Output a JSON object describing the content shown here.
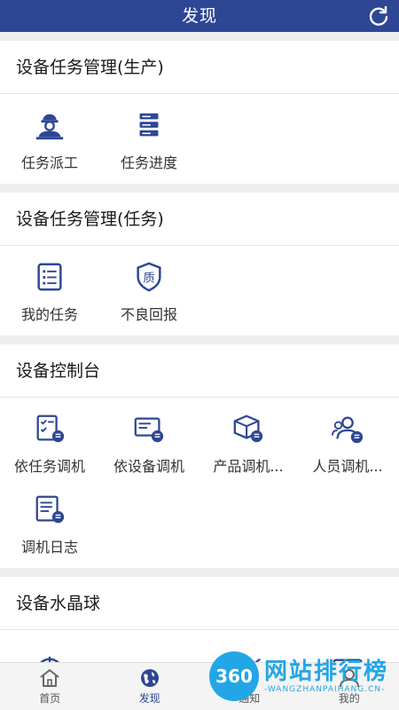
{
  "header": {
    "title": "发现",
    "refresh_icon": "refresh-icon"
  },
  "colors": {
    "primary": "#2e4795",
    "background": "#eeeeee",
    "watermark": "#23a6e6"
  },
  "sections": [
    {
      "title": "设备任务管理(生产)",
      "items": [
        {
          "label": "任务派工",
          "icon": "worker-icon"
        },
        {
          "label": "任务进度",
          "icon": "stack-icon"
        }
      ]
    },
    {
      "title": "设备任务管理(任务)",
      "items": [
        {
          "label": "我的任务",
          "icon": "list-icon"
        },
        {
          "label": "不良回报",
          "icon": "shield-quality-icon",
          "glyph": "质"
        }
      ]
    },
    {
      "title": "设备控制台",
      "items": [
        {
          "label": "依任务调机",
          "icon": "task-adjust-icon"
        },
        {
          "label": "依设备调机",
          "icon": "device-adjust-icon"
        },
        {
          "label": "产品调机...",
          "icon": "box-adjust-icon"
        },
        {
          "label": "人员调机...",
          "icon": "people-adjust-icon"
        },
        {
          "label": "调机日志",
          "icon": "log-icon"
        }
      ]
    },
    {
      "title": "设备水晶球",
      "items": [
        {
          "label": "",
          "icon": "target-icon"
        },
        {
          "label": "",
          "icon": "gauge-icon"
        },
        {
          "label": "",
          "icon": "bar-chart-icon"
        },
        {
          "label": "",
          "icon": "monitor-icon"
        }
      ]
    }
  ],
  "tabs": [
    {
      "label": "首页",
      "icon": "home-icon"
    },
    {
      "label": "发现",
      "icon": "globe-icon",
      "active": true
    },
    {
      "label": "通知",
      "icon": "bell-icon"
    },
    {
      "label": "我的",
      "icon": "user-icon"
    }
  ],
  "watermark": {
    "logo": "360",
    "title": "网站排行榜",
    "subtitle": "-WANGZHANPAIHANG.CN-"
  }
}
